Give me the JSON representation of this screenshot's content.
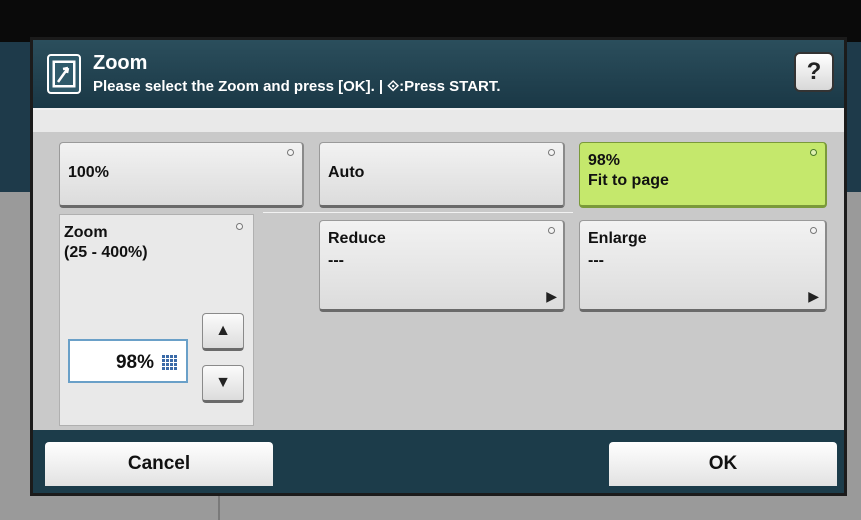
{
  "dialog": {
    "title": "Zoom",
    "subtitle": "Please select the Zoom and press [OK]. | ⟐:Press START.",
    "help_label": "?"
  },
  "presets": [
    {
      "label": "100%",
      "selected": false
    },
    {
      "label": "Auto",
      "selected": false
    },
    {
      "label": "98%\nFit to page",
      "selected": true
    }
  ],
  "zoom": {
    "label": "Zoom\n(25 - 400%)",
    "value": "98%",
    "up_label": "▲",
    "down_label": "▼"
  },
  "reduce": {
    "label": "Reduce",
    "value": "---"
  },
  "enlarge": {
    "label": "Enlarge",
    "value": "---"
  },
  "footer": {
    "cancel_label": "Cancel",
    "ok_label": "OK"
  },
  "colors": {
    "selected": "#c5e86c",
    "header": "#1f4050",
    "footer": "#1c3c4a"
  }
}
